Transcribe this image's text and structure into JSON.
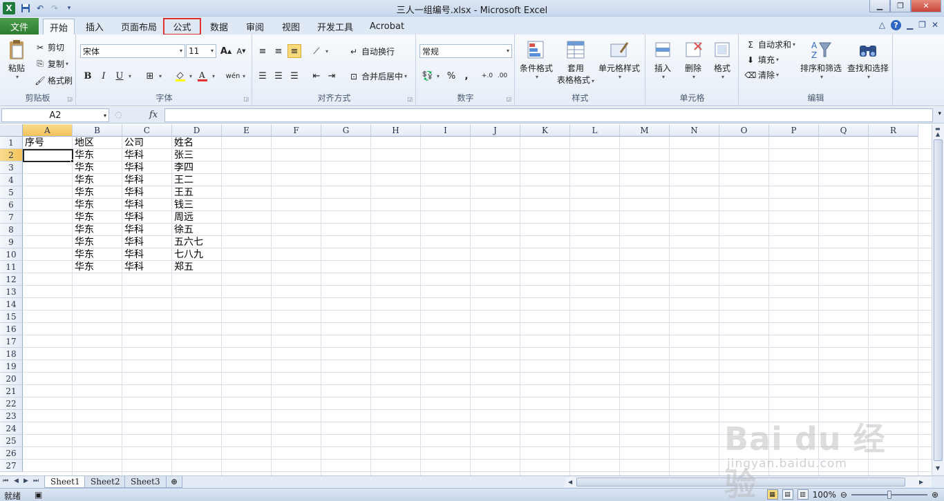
{
  "window": {
    "title": "三人一组编号.xlsx  -  Microsoft Excel",
    "app_logo": "X",
    "qat_icons": [
      "save-icon",
      "undo-icon",
      "redo-icon",
      "customize-qat-icon"
    ],
    "controls": [
      "minimize",
      "maximize",
      "close"
    ]
  },
  "tabs": [
    {
      "label": "文件"
    },
    {
      "label": "开始"
    },
    {
      "label": "插入"
    },
    {
      "label": "页面布局"
    },
    {
      "label": "公式"
    },
    {
      "label": "数据"
    },
    {
      "label": "审阅"
    },
    {
      "label": "视图"
    },
    {
      "label": "开发工具"
    },
    {
      "label": "Acrobat"
    }
  ],
  "ribbon": {
    "clipboard": {
      "label": "剪贴板",
      "paste": "粘贴",
      "cut": "剪切",
      "copy": "复制",
      "format_painter": "格式刷"
    },
    "font": {
      "label": "字体",
      "name": "宋体",
      "size": "11",
      "grow": "A",
      "shrink": "A",
      "bold": "B",
      "italic": "I",
      "underline": "U",
      "phonetic": "wén"
    },
    "alignment": {
      "label": "对齐方式",
      "wrap": "自动换行",
      "merge": "合并后居中"
    },
    "number": {
      "label": "数字",
      "format": "常规",
      "percent": "%",
      "comma": ","
    },
    "styles": {
      "label": "样式",
      "conditional": "条件格式",
      "table_format_1": "套用",
      "table_format_2": "表格格式",
      "cell_styles": "单元格样式"
    },
    "cells": {
      "label": "单元格",
      "insert": "插入",
      "delete": "删除",
      "format": "格式"
    },
    "editing": {
      "label": "编辑",
      "autosum": "自动求和",
      "fill": "填充",
      "clear": "清除",
      "sort_filter": "排序和筛选",
      "find_select": "查找和选择"
    }
  },
  "formula_bar": {
    "name_box": "A2",
    "fx": "fx",
    "value": ""
  },
  "grid": {
    "columns": [
      "A",
      "B",
      "C",
      "D",
      "E",
      "F",
      "G",
      "H",
      "I",
      "J",
      "K",
      "L",
      "M",
      "N",
      "O",
      "P",
      "Q",
      "R"
    ],
    "row_numbers": [
      "1",
      "2",
      "3",
      "4",
      "5",
      "6",
      "7",
      "8",
      "9",
      "10",
      "11",
      "12",
      "13",
      "14",
      "15",
      "16",
      "17",
      "18",
      "19",
      "20",
      "21",
      "22",
      "23",
      "24",
      "25",
      "26",
      "27"
    ],
    "selected_column": "A",
    "selected_row": "2",
    "rows": [
      [
        "序号",
        "地区",
        "公司",
        "姓名"
      ],
      [
        "",
        "华东",
        "华科",
        "张三"
      ],
      [
        "",
        "华东",
        "华科",
        "李四"
      ],
      [
        "",
        "华东",
        "华科",
        "王二"
      ],
      [
        "",
        "华东",
        "华科",
        "王五"
      ],
      [
        "",
        "华东",
        "华科",
        "钱三"
      ],
      [
        "",
        "华东",
        "华科",
        "周远"
      ],
      [
        "",
        "华东",
        "华科",
        "徐五"
      ],
      [
        "",
        "华东",
        "华科",
        "五六七"
      ],
      [
        "",
        "华东",
        "华科",
        "七八九"
      ],
      [
        "",
        "华东",
        "华科",
        "郑五"
      ]
    ]
  },
  "sheets": [
    {
      "name": "Sheet1"
    },
    {
      "name": "Sheet2"
    },
    {
      "name": "Sheet3"
    }
  ],
  "status": {
    "text": "就绪",
    "zoom": "100%"
  },
  "watermark": {
    "brand": "Bai du 经验",
    "url": "jingyan.baidu.com"
  },
  "colors": {
    "file_tab": "#2e7d32",
    "highlight_box": "#e0322e",
    "selected_header": "#f2c35a"
  }
}
